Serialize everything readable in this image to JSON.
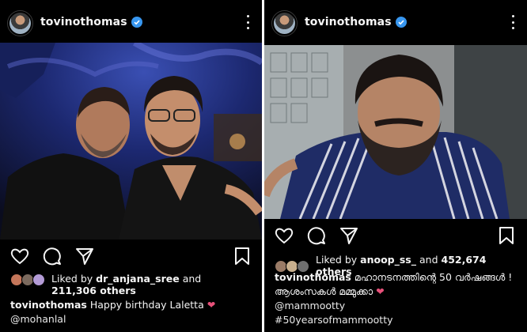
{
  "posts": [
    {
      "username": "tovinothomas",
      "liked_by_user": "dr_anjana_sree",
      "liked_others": "211,306 others",
      "caption_user": "tovinothomas",
      "caption_text": "Happy birthday Laletta",
      "caption_emoji": "❤",
      "caption_lines": [
        "@mohanlal"
      ]
    },
    {
      "username": "tovinothomas",
      "liked_by_user": "anoop_ss_",
      "liked_others": "452,674 others",
      "caption_user": "tovinothomas",
      "caption_text": "മഹാനടനത്തിന്റെ 50 വർഷങ്ങൾ !",
      "caption_line2": "ആശംസകൾ മമ്മുക്കാ",
      "caption_emoji": "❤",
      "caption_lines": [
        "@mammootty",
        "#50yearsofmammootty"
      ]
    }
  ],
  "labels": {
    "liked_by": "Liked by",
    "and": "and"
  },
  "icons": [
    "verified-badge-icon",
    "more-options-icon",
    "heart-icon",
    "comment-icon",
    "share-icon",
    "bookmark-icon"
  ],
  "colors": {
    "background": "#000000",
    "text": "#f5f5f5",
    "verified": "#3897f0",
    "heart_emoji": "#e8517a",
    "divider": "#ffffff"
  }
}
